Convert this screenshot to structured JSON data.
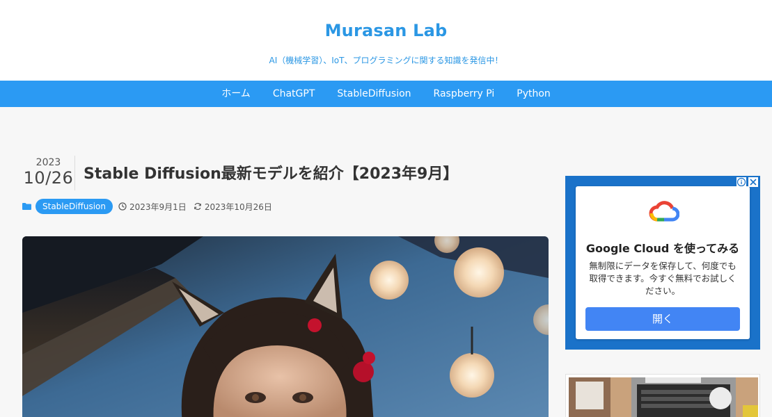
{
  "site": {
    "title": "Murasan Lab",
    "tagline": "AI（機械学習）、IoT、プログラミングに関する知識を発信中！"
  },
  "nav": {
    "items": [
      "ホーム",
      "ChatGPT",
      "StableDiffusion",
      "Raspberry Pi",
      "Python"
    ]
  },
  "post": {
    "date_year": "2023",
    "date_md": "10/26",
    "title": "Stable Diffusion最新モデルを紹介【2023年9月】",
    "category": "StableDiffusion",
    "published": "2023年9月1日",
    "updated": "2023年10月26日",
    "hero_icon": "anime-cat-girl-photo"
  },
  "ad": {
    "headline": "Google Cloud を使ってみる",
    "body": "無制限にデータを保存して、何度でも取得できます。今すぐ無料でお試しください。",
    "button": "開く",
    "logo_icon": "google-cloud-logo"
  },
  "sidebar": {
    "thumb_icon": "laptop-desk-photo"
  },
  "colors": {
    "accent": "#2b9af3",
    "title_blue": "#2b97e4",
    "ad_button": "#4285f4"
  }
}
